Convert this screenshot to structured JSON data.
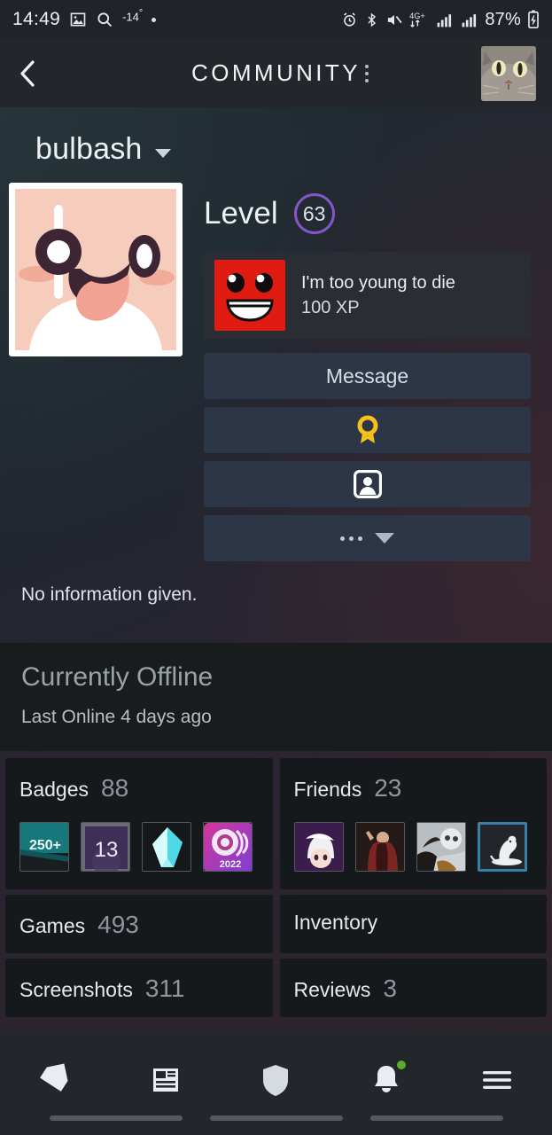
{
  "statusbar": {
    "time": "14:49",
    "temperature": "-14",
    "temp_unit": "°",
    "battery": "87%",
    "icons": [
      "image-icon",
      "search-icon",
      "notification-dot",
      "alarm-icon",
      "bluetooth-icon",
      "mute-icon",
      "network-4g-plus-icon",
      "signal-bars-icon",
      "signal-bars-2-icon",
      "battery-charging-icon"
    ]
  },
  "header": {
    "back_label": "back",
    "title": "COMMUNITY",
    "menu_label": "more-options",
    "avatar_label": "cat-avatar"
  },
  "profile": {
    "username": "bulbash",
    "dropdown_label": "profile-menu",
    "level_label": "Level",
    "level_value": "63",
    "level_ring_color": "#8257c8",
    "avatar_label": "user-avatar",
    "featured_badge": {
      "name": "I'm too young to die",
      "xp": "100 XP",
      "icon_label": "meat-boy-badge"
    },
    "about_text": "No information given."
  },
  "actions": [
    {
      "label": "Message",
      "name": "message-button",
      "type": "text"
    },
    {
      "label": "award-icon",
      "name": "nominate-award-button",
      "type": "icon"
    },
    {
      "label": "profile-icon",
      "name": "add-friend-button",
      "type": "icon"
    },
    {
      "label": "...",
      "name": "more-actions-button",
      "type": "more"
    }
  ],
  "status": {
    "title": "Currently Offline",
    "subtitle": "Last Online 4 days ago"
  },
  "stats": {
    "badges": {
      "label": "Badges",
      "count": "88",
      "thumbs": [
        "badge-250-plus",
        "badge-level-13",
        "badge-gem",
        "badge-steam-2022"
      ]
    },
    "friends": {
      "label": "Friends",
      "count": "23",
      "thumbs": [
        "friend-anime-avatar",
        "friend-robed-man-avatar",
        "friend-skull-avatar",
        "friend-rat-avatar-online"
      ]
    },
    "games": {
      "label": "Games",
      "count": "493"
    },
    "inventory": {
      "label": "Inventory",
      "count": ""
    },
    "screenshots": {
      "label": "Screenshots",
      "count": "311"
    },
    "reviews": {
      "label": "Reviews",
      "count": "3"
    }
  },
  "bottom_nav": [
    {
      "name": "nav-store",
      "icon": "tag-icon"
    },
    {
      "name": "nav-library",
      "icon": "news-article-icon"
    },
    {
      "name": "nav-community",
      "icon": "shield-icon"
    },
    {
      "name": "nav-notifications",
      "icon": "bell-icon",
      "badge": true
    },
    {
      "name": "nav-menu",
      "icon": "hamburger-menu-icon"
    }
  ]
}
